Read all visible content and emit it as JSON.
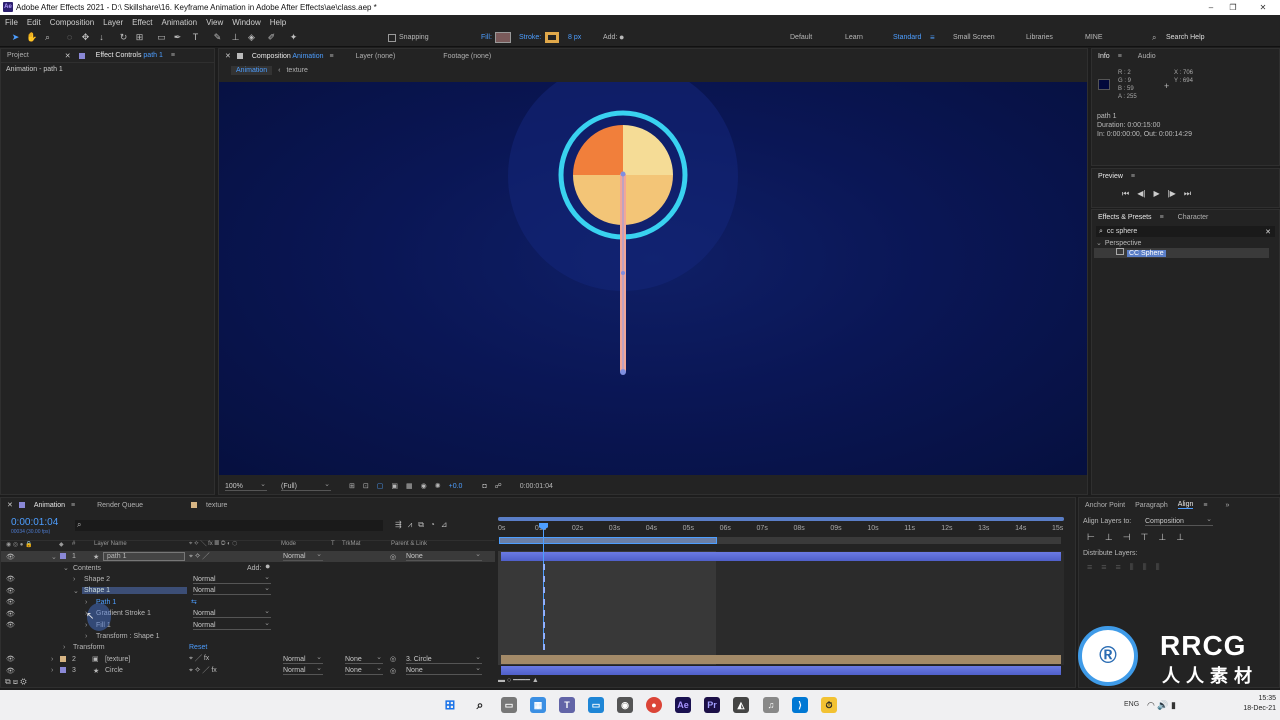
{
  "window": {
    "title": "Adobe After Effects 2021 - D:\\ Skillshare\\16. Keyframe Animation in Adobe After Effects\\ae\\class.aep *",
    "logo": "Ae",
    "minimize": "–",
    "maximize": "❐",
    "close": "✕"
  },
  "menu": [
    "File",
    "Edit",
    "Composition",
    "Layer",
    "Effect",
    "Animation",
    "View",
    "Window",
    "Help"
  ],
  "toolbar": {
    "snapping": "Snapping",
    "fill": "Fill:",
    "stroke": "Stroke:",
    "stroke_width": "8 px",
    "add": "Add:",
    "workspaces": [
      "Default",
      "Learn",
      "Standard",
      "Small Screen",
      "Libraries",
      "MINE"
    ],
    "active_workspace": "Standard",
    "search": "Search Help"
  },
  "left_panel": {
    "tab_project": "Project",
    "tab_effect_controls": "Effect Controls",
    "effect_controls_target": "path 1",
    "subtitle": "Animation - path 1"
  },
  "comp_panel": {
    "tab": "Composition",
    "comp_name": "Animation",
    "tab_layer": "Layer (none)",
    "tab_footage": "Footage (none)",
    "breadcrumb": [
      "Animation",
      "texture"
    ],
    "zoom": "100%",
    "resolution": "(Full)",
    "exposure": "+0.0",
    "timecode": "0:00:01:04"
  },
  "info": {
    "tab_info": "Info",
    "tab_audio": "Audio",
    "r": "R : 2",
    "g": "G : 9",
    "b": "B : 59",
    "a": "A : 255",
    "x": "X : 706",
    "y": "Y : 694",
    "layer": "path 1",
    "duration": "Duration: 0:00:15:00",
    "inout": "In: 0:00:00:00, Out: 0:00:14:29",
    "swatch_color": "#02093b"
  },
  "preview": {
    "title": "Preview",
    "controls": [
      "⏮",
      "◀|",
      "▶",
      "|▶",
      "⏭"
    ]
  },
  "effects": {
    "tab": "Effects & Presets",
    "tab_character": "Character",
    "search": "cc sphere",
    "category": "Perspective",
    "item": "CC Sphere"
  },
  "timeline": {
    "tab": "Animation",
    "tab_render": "Render Queue",
    "tab_texture": "texture",
    "timecode": "0:00:01:04",
    "fps": "00034 (30.00 fps)",
    "headers": {
      "layer_name": "Layer Name",
      "mode": "Mode",
      "t": "T",
      "trkmat": "TrkMat",
      "parent": "Parent & Link"
    },
    "ruler": [
      "0s",
      "01s",
      "02s",
      "03s",
      "04s",
      "05s",
      "06s",
      "07s",
      "08s",
      "09s",
      "10s",
      "11s",
      "12s",
      "13s",
      "14s",
      "15s"
    ],
    "layers": [
      {
        "num": "1",
        "name": "path 1",
        "mode": "Normal",
        "trkmat": "",
        "parent": "None"
      },
      {
        "num": "2",
        "name": "[texture]",
        "mode": "Normal",
        "trkmat": "None",
        "parent": "3. Circle"
      },
      {
        "num": "3",
        "name": "Circle",
        "mode": "Normal",
        "trkmat": "None",
        "parent": "None"
      }
    ],
    "contents": "Contents",
    "add": "Add:",
    "shape2": "Shape 2",
    "shape1": "Shape 1",
    "path": "Path 1",
    "grad": "Gradient Stroke 1",
    "fill": "Fill 1",
    "transform_shape": "Transform : Shape 1",
    "transform": "Transform",
    "reset": "Reset",
    "normal": "Normal"
  },
  "align": {
    "tab_anchor": "Anchor Point",
    "tab_paragraph": "Paragraph",
    "tab_align": "Align",
    "align_to_label": "Align Layers to:",
    "align_to": "Composition",
    "distribute": "Distribute Layers:"
  },
  "taskbar": {
    "lang": "ENG",
    "time": "15:35",
    "date": "18-Dec-21"
  },
  "watermark": {
    "brand": "RRCG",
    "sub": "人人素材"
  }
}
